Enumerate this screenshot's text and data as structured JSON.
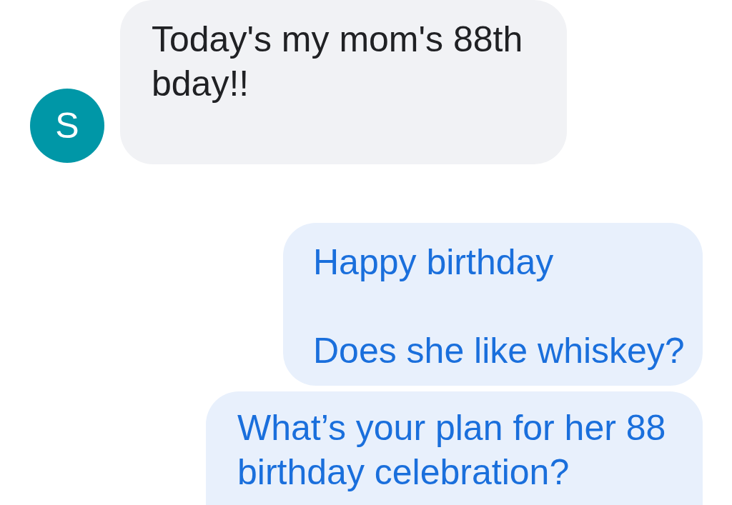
{
  "messages": [
    {
      "kind": "incoming",
      "avatar": "S",
      "text": "Today's my mom's 88th bday!!"
    },
    {
      "kind": "outgoing",
      "text": "Happy birthday\n\nDoes she like whiskey?"
    },
    {
      "kind": "outgoing",
      "text": "What’s your plan for her 88 birthday celebration?"
    }
  ]
}
